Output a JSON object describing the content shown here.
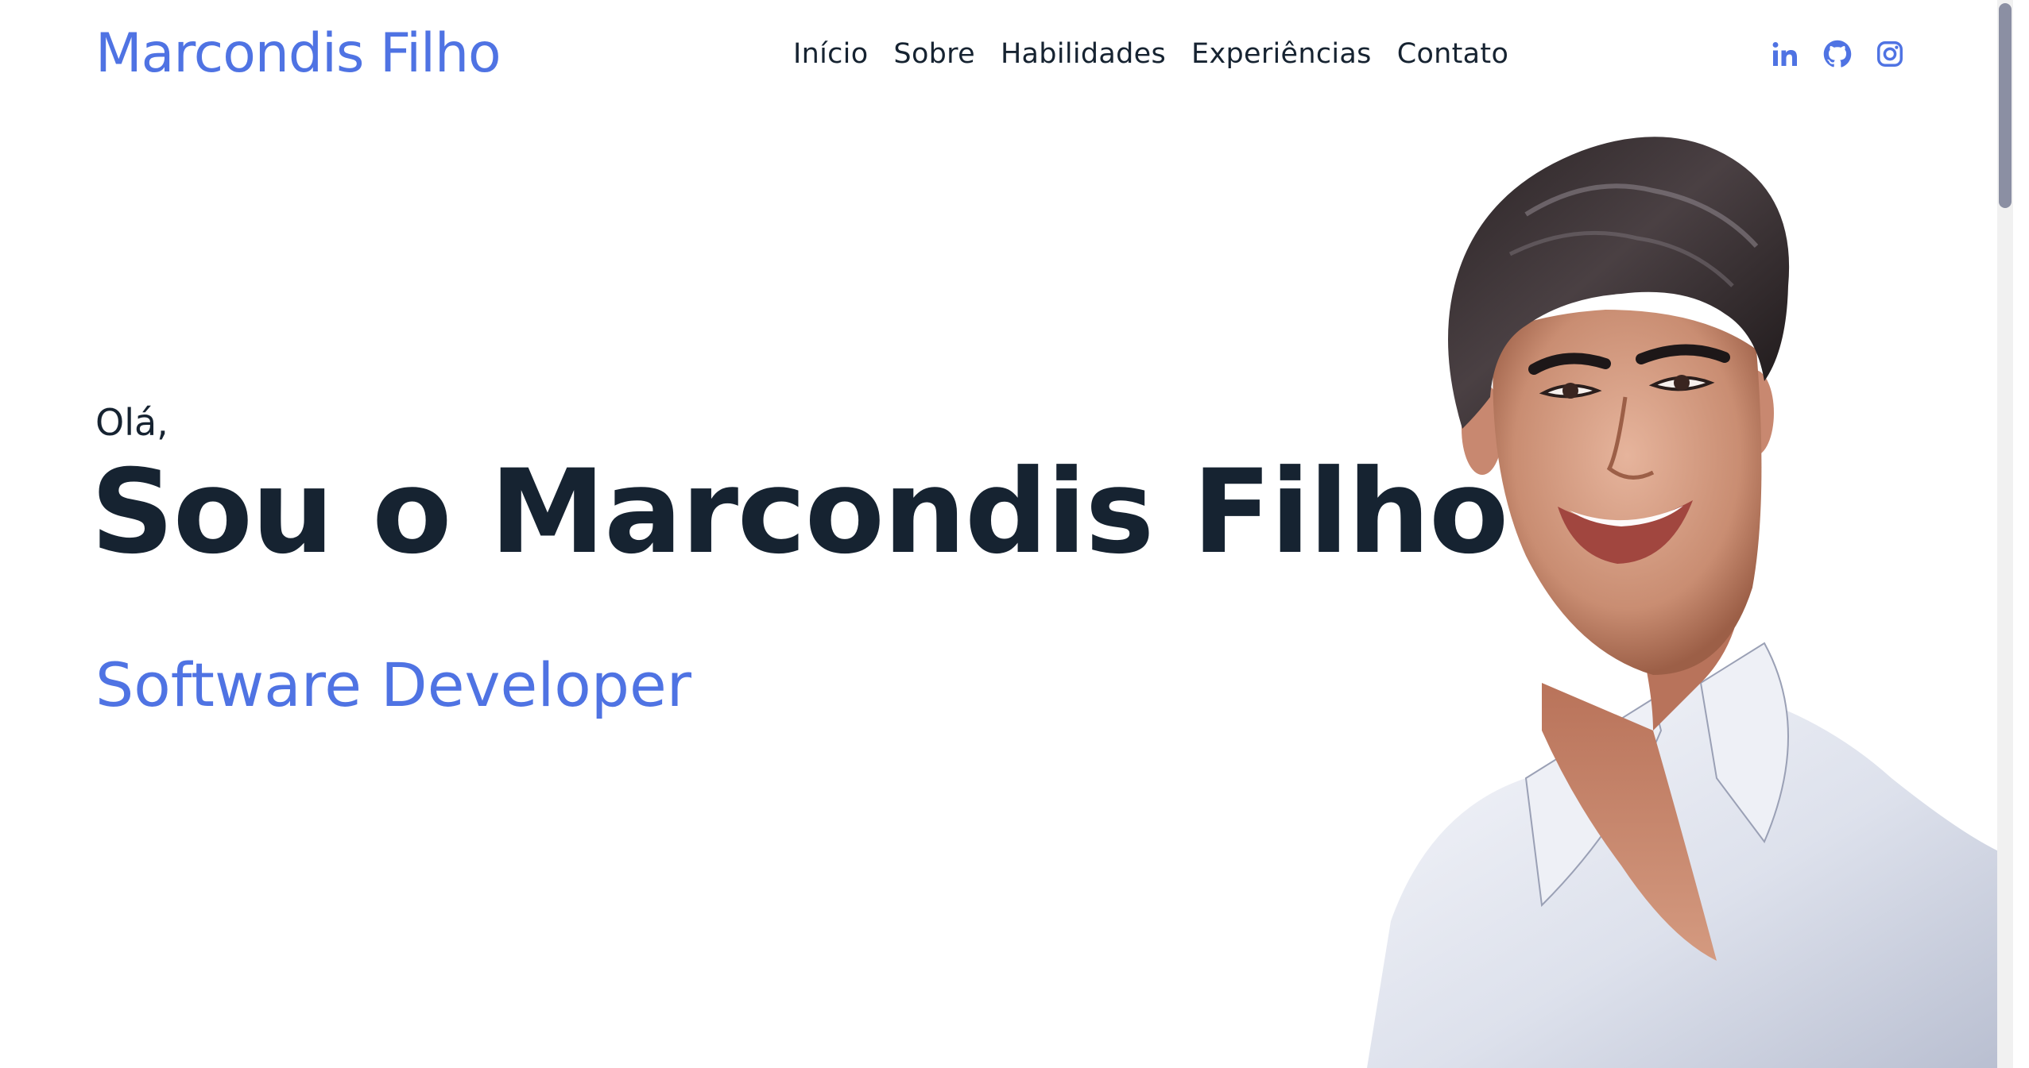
{
  "header": {
    "logo": "Marcondis Filho",
    "nav": [
      "Início",
      "Sobre",
      "Habilidades",
      "Experiências",
      "Contato"
    ],
    "social_icons": [
      "linkedin-icon",
      "github-icon",
      "instagram-icon"
    ]
  },
  "hero": {
    "greeting": "Olá,",
    "title": "Sou o Marcondis Filho",
    "role": "Software Developer"
  },
  "colors": {
    "accent": "#4f73e3",
    "text": "#162331",
    "background": "#ffffff"
  }
}
